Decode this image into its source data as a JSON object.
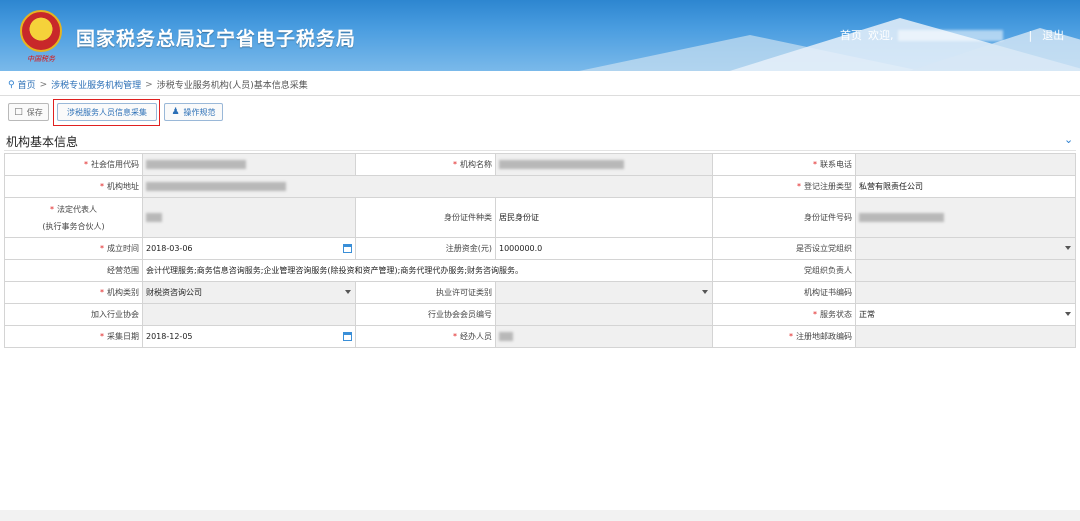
{
  "header": {
    "site_title": "国家税务总局辽宁省电子税务局",
    "emblem_caption": "中国税务",
    "nav_home": "首页",
    "nav_welcome": "欢迎,",
    "nav_sep": "|",
    "nav_logout": "退出"
  },
  "breadcrumb": {
    "home": "首页",
    "sep1": ">",
    "level1": "涉税专业服务机构管理",
    "sep2": ">",
    "current": "涉税专业服务机构(人员)基本信息采集"
  },
  "toolbar": {
    "save_label": "保存",
    "collect_label": "涉税服务人员信息采集",
    "rule_label": "操作规范"
  },
  "section": {
    "title": "机构基本信息"
  },
  "form": {
    "credit_code_label": "社会信用代码",
    "org_name_label": "机构名称",
    "phone_label": "联系电话",
    "address_label": "机构地址",
    "reg_type_label": "登记注册类型",
    "reg_type_value": "私营有限责任公司",
    "legal_rep_label": "法定代表人",
    "legal_rep_sub": "(执行事务合伙人)",
    "id_type_label": "身份证件种类",
    "id_type_value": "居民身份证",
    "id_no_label": "身份证件号码",
    "est_date_label": "成立时间",
    "est_date_value": "2018-03-06",
    "capital_label": "注册资金(元)",
    "capital_value": "1000000.0",
    "party_org_label": "是否设立党组织",
    "scope_label": "经营范围",
    "scope_value": "会计代理服务;商务信息咨询服务;企业管理咨询服务(除投资和资产管理);商务代理代办服务;财务咨询服务。",
    "party_leader_label": "党组织负责人",
    "org_type_label": "机构类别",
    "org_type_value": "财税资咨询公司",
    "license_type_label": "执业许可证类别",
    "cert_no_label": "机构证书编码",
    "assoc_label": "加入行业协会",
    "assoc_no_label": "行业协会会员编号",
    "service_status_label": "服务状态",
    "service_status_value": "正常",
    "collect_date_label": "采集日期",
    "collect_date_value": "2018-12-05",
    "handler_label": "经办人员",
    "postcode_label": "注册地邮政编码",
    "required_mark": "*"
  },
  "icons": {
    "pin": "map-pin-icon",
    "save": "save-icon",
    "rule": "user-guide-icon",
    "collapse": "chevron-down-icon",
    "calendar": "calendar-icon"
  },
  "colors": {
    "header_blue": "#2d86d0",
    "link_blue": "#2b6fb6",
    "required_red": "#e02020",
    "highlight_red": "#e02020"
  }
}
